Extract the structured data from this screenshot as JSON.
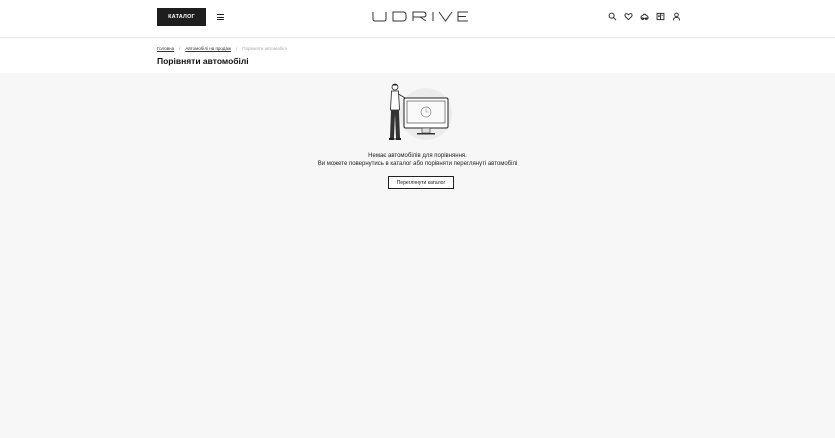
{
  "header": {
    "catalog_label": "КАТАЛОГ",
    "logo_text": "UDRIVE",
    "icons": [
      "search-icon",
      "heart-icon",
      "compare-icon",
      "book-icon",
      "user-icon"
    ]
  },
  "breadcrumb": {
    "items": [
      "Головна",
      "Автомобілі на продаж"
    ],
    "current": "Порівняти автомобілі"
  },
  "page": {
    "title": "Порівняти автомобілі"
  },
  "empty_state": {
    "line1": "Немає автомобілів для порівняння.",
    "line2": "Ви можете повернутись в каталог або порівняти переглянуті автомобілі",
    "button_label": "Переглянути каталог"
  }
}
